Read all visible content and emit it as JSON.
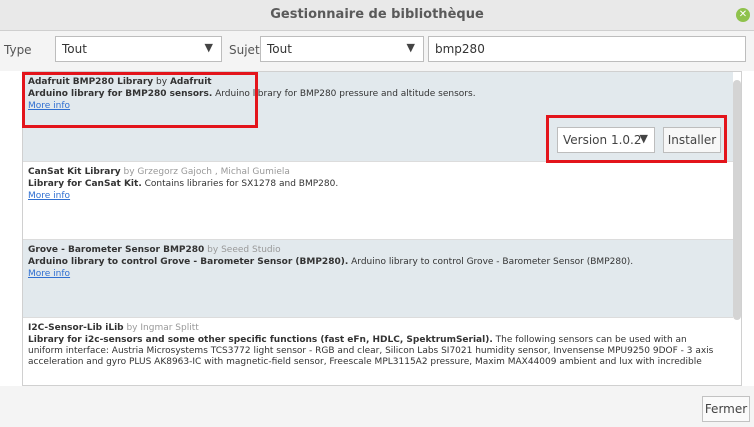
{
  "window": {
    "title": "Gestionnaire de bibliothèque"
  },
  "filters": {
    "type_label": "Type",
    "type_value": "Tout",
    "topic_label": "Sujet",
    "topic_value": "Tout",
    "search_value": "bmp280"
  },
  "libraries": [
    {
      "name": "Adafruit BMP280 Library",
      "by": " by ",
      "author": "Adafruit",
      "summary": "Arduino library for BMP280 sensors.",
      "description": " Arduino library for BMP280 pressure and altitude sensors.",
      "more": "More info"
    },
    {
      "name": "CanSat Kit Library",
      "by": " by ",
      "author": "Grzegorz Gajoch , Michal Gumiela",
      "summary": "Library for CanSat Kit.",
      "description": " Contains libraries for SX1278 and BMP280.",
      "more": "More info"
    },
    {
      "name": "Grove - Barometer Sensor BMP280",
      "by": " by ",
      "author": "Seeed Studio",
      "summary": "Arduino library to control Grove - Barometer Sensor (BMP280).",
      "description": " Arduino library to control Grove - Barometer Sensor (BMP280).",
      "more": "More info"
    },
    {
      "name": "I2C-Sensor-Lib iLib",
      "by": " by ",
      "author": "Ingmar Splitt",
      "summary": "Library for i2c-sensors and some other specific functions (fast eFn, HDLC, SpektrumSerial).",
      "description": " The following sensors can be used with an uniform interface: Austria Microsystems TCS3772 light sensor - RGB and clear, Silicon Labs SI7021 humidity sensor, Invensense MPU9250 9DOF - 3 axis acceleration and gyro PLUS AK8963-IC with magnetic-field sensor, Freescale MPL3115A2 pressure, Maxim MAX44009 ambient and lux with incredible",
      "more": ""
    }
  ],
  "install": {
    "version": "Version 1.0.2",
    "button": "Installer"
  },
  "footer": {
    "close": "Fermer"
  },
  "colors": {
    "highlight": "#e3141b",
    "link": "#2f6fd1"
  }
}
